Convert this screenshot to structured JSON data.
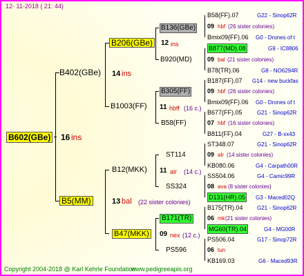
{
  "header": {
    "date": "12- 11-2018 ( 21: 44)"
  },
  "footer": {
    "copyright": "Copyright 2004-2018 @ Karl Kehrle Foundation",
    "url": "www.pedigreeapis.org"
  },
  "colors": {
    "border": "#ff00ff",
    "highlight_yellow": "#ffff00",
    "highlight_grey": "#b0b0b0",
    "highlight_green": "#33ff33"
  },
  "gen1": {
    "name": "B602(GBe)",
    "num": "16",
    "tag": "ins"
  },
  "gen2": [
    {
      "name": "B402(GBe)",
      "num": "14",
      "tag": "ins"
    },
    {
      "name": "B5(MM)",
      "num": "13",
      "tag": "bal",
      "note": "(22 sister colonies)"
    }
  ],
  "gen3": [
    {
      "name": "B206(GBe)",
      "num": "12",
      "tag": "ins"
    },
    {
      "name": "B1003(FF)",
      "num": "11",
      "tag": "hbff",
      "note": "(16 c.)"
    },
    {
      "name": "B12(MKK)",
      "num": "11",
      "tag": "alr",
      "note": "(14 c.)"
    },
    {
      "name": "B47(MKK)",
      "num": "09",
      "tag": "nex",
      "note": "(12 c.)"
    }
  ],
  "gen4": [
    {
      "name": "B136(GBe)"
    },
    {
      "name": "B920(MD)"
    },
    {
      "name": "B305(FF)"
    },
    {
      "name": "B58(FF)"
    },
    {
      "name": "ST114"
    },
    {
      "name": "SS324"
    },
    {
      "name": "B171(TR)"
    },
    {
      "name": "PS596"
    }
  ],
  "gen5": [
    {
      "name": "B58(FF).07",
      "ref": "G22 - Sinop62R"
    },
    {
      "num": "09",
      "tag": "hbf",
      "note": "(26 sister colonies)"
    },
    {
      "name": "Bmix09(FF).06",
      "ref": "G0 - Drones of t"
    },
    {
      "name": "B877(MD).08",
      "ref": "G9 - IC8806"
    },
    {
      "num": "09",
      "tag": "bal",
      "note": "(21 sister colonies)"
    },
    {
      "name": "B78(TR).06",
      "ref": "G8 - NO6294R"
    },
    {
      "name": "B187(FF).07",
      "ref": "G14 - new buckfas"
    },
    {
      "num": "09",
      "tag": "hbf",
      "note": "(26 sister colonies)"
    },
    {
      "name": "Bmix09(FF).06",
      "ref": "G0 - Drones of t"
    },
    {
      "name": "B677(FF).05",
      "ref": "G21 - Sinop62R"
    },
    {
      "num": "07",
      "tag": "hbf",
      "note": "(16 sister colonies)"
    },
    {
      "name": "B811(FF).04",
      "ref": "G27 - B-xx43"
    },
    {
      "name": "ST348.07",
      "ref": "G21 - Sinop62R"
    },
    {
      "num": "09",
      "tag": "alr",
      "note": "(14 sister colonies)"
    },
    {
      "name": "KB080.06",
      "ref": "G4 - Carpath00R"
    },
    {
      "name": "SS504.06",
      "ref": "G4 - Camic99R"
    },
    {
      "num": "08",
      "tag": "ava",
      "note": "(8 sister colonies)"
    },
    {
      "name": "D131(HR).05",
      "ref": "G3 - Maced02Q"
    },
    {
      "name": "B175(TR).04",
      "ref": "G21 - Sinop62R"
    },
    {
      "num": "06",
      "tag": "mk",
      "note": "(21 sister colonies)"
    },
    {
      "name": "MG60(TR).04",
      "ref": "G4 - MG00R"
    },
    {
      "name": "PS506.04",
      "ref": "G17 - Sinop72R"
    },
    {
      "num": "06",
      "tag": "tun"
    },
    {
      "name": "KB169.03",
      "ref": "G6 - Maced93R"
    }
  ]
}
